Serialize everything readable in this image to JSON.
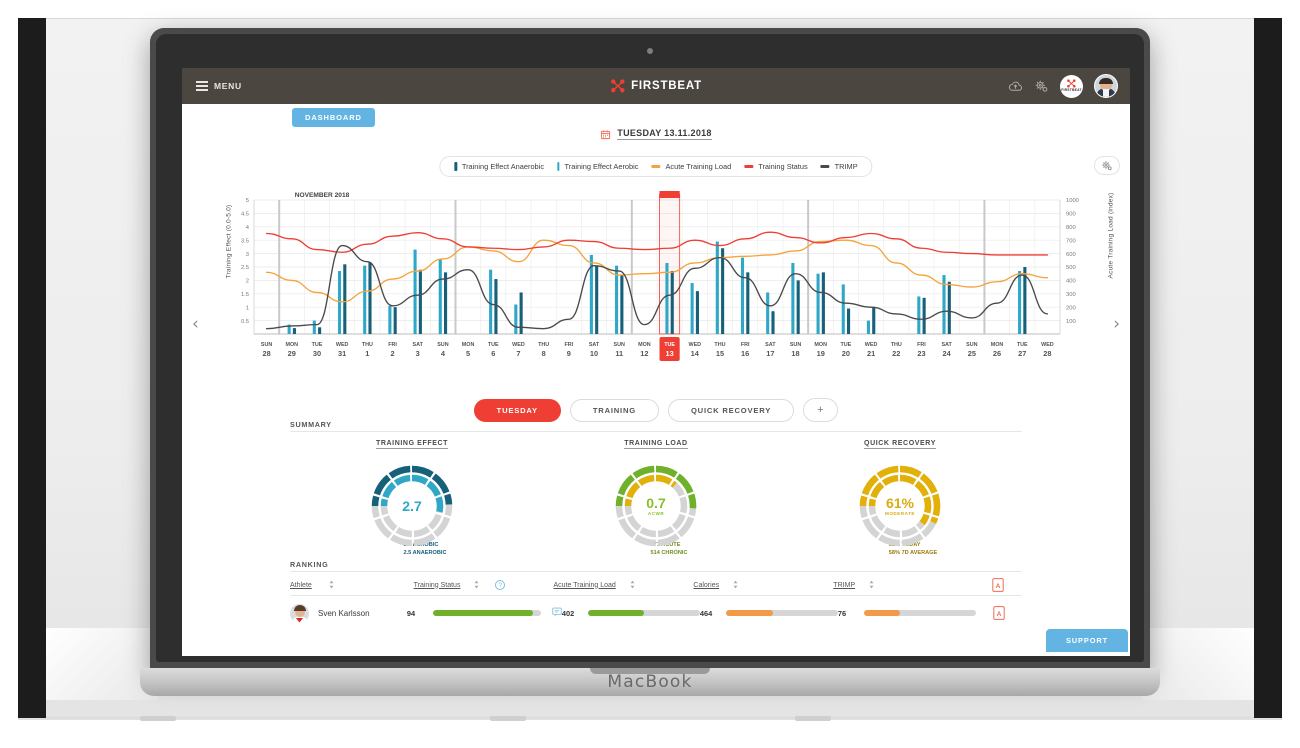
{
  "device": {
    "label": "MacBook"
  },
  "appbar": {
    "menu_label": "MENU",
    "brand": "FIRSTBEAT",
    "badge_text": "FIRSTBEAT",
    "icons": [
      "cloud-upload-icon",
      "settings-gears-icon",
      "firstbeat-badge-icon",
      "user-avatar-icon"
    ]
  },
  "dashboard_tag": "DASHBOARD",
  "date": {
    "text": "TUESDAY 13.11.2018",
    "icon": "calendar-icon"
  },
  "legend": {
    "items": [
      {
        "label": "Training Effect Anaerobic",
        "marker": "bar",
        "color": "#17607a"
      },
      {
        "label": "Training Effect Aerobic",
        "marker": "bar",
        "color": "#2fa8c8"
      },
      {
        "label": "Acute Training Load",
        "marker": "line",
        "color": "#f5a33c"
      },
      {
        "label": "Training Status",
        "marker": "line",
        "color": "#ef3e33"
      },
      {
        "label": "TRIMP",
        "marker": "line",
        "color": "#4a4a4a"
      }
    ],
    "settings_icon": "chart-settings-icon"
  },
  "nav": {
    "prev": "‹",
    "next": "›"
  },
  "tabs": [
    {
      "label": "TUESDAY",
      "active": true
    },
    {
      "label": "TRAINING",
      "active": false
    },
    {
      "label": "QUICK RECOVERY",
      "active": false
    },
    {
      "label": "+",
      "active": false
    }
  ],
  "summary": {
    "section_label": "SUMMARY",
    "cards": [
      {
        "title": "TRAINING EFFECT",
        "main": "2.7",
        "sub": "",
        "main_color": "#2fa8c8",
        "caption": [
          "2.7 AEROBIC",
          "2.5 ANAEROBIC"
        ],
        "caption_color": "#17607a",
        "rings": [
          {
            "value": 2.7,
            "max": 5.0,
            "color": "#2fa8c8",
            "r": 28
          },
          {
            "value": 2.5,
            "max": 5.0,
            "color": "#17607a",
            "r": 37
          }
        ]
      },
      {
        "title": "TRAINING LOAD",
        "main": "0.7",
        "sub": "ACWR",
        "main_color": "#8bbf2a",
        "caption": [
          "371 ACUTE",
          "514 CHRONIC"
        ],
        "caption_color": "#6f8f1e",
        "rings": [
          {
            "value": 371,
            "max": 1000,
            "color": "#e3b007",
            "r": 28
          },
          {
            "value": 514,
            "max": 1000,
            "color": "#6fb12a",
            "r": 37
          }
        ]
      },
      {
        "title": "QUICK RECOVERY",
        "main": "61%",
        "sub": "MODERATE",
        "main_color": "#d9ac10",
        "caption": [
          "61% TODAY",
          "58% 7D AVERAGE"
        ],
        "caption_color": "#9a7c0a",
        "rings": [
          {
            "value": 61,
            "max": 100,
            "color": "#e3b007",
            "r": 28
          },
          {
            "value": 58,
            "max": 100,
            "color": "#e3b007",
            "r": 37
          }
        ]
      }
    ]
  },
  "ranking": {
    "section_label": "RANKING",
    "columns": [
      {
        "label": "Athlete",
        "sortable": true
      },
      {
        "label": "Training Status",
        "sortable": true,
        "has_help": true
      },
      {
        "label": "Acute Training Load",
        "sortable": true
      },
      {
        "label": "Calories",
        "sortable": true
      },
      {
        "label": "TRIMP",
        "sortable": true
      }
    ],
    "rows": [
      {
        "name": "Sven Karlsson",
        "training_status": {
          "value": "94",
          "pct": 93,
          "color": "#6fb12a",
          "note_icon": "comment-icon"
        },
        "acute_training_load": {
          "value": "402",
          "pct": 50,
          "color": "#6fb12a"
        },
        "calories": {
          "value": "464",
          "pct": 42,
          "color": "#f2994a"
        },
        "trimp": {
          "value": "76",
          "pct": 32,
          "color": "#f2994a"
        },
        "pdf_icon": "pdf-download-icon"
      }
    ]
  },
  "support": {
    "label": "SUPPORT"
  },
  "chart_data": {
    "type": "bar",
    "title": "NOVEMBER 2018",
    "xlabel": "",
    "ylabel": "Training Effect (0.0-5.0)",
    "y2label": "Acute Training Load (index)",
    "ylim": [
      0,
      5
    ],
    "yticks": [
      0.5,
      1,
      1.5,
      2,
      2.5,
      3,
      3.5,
      4,
      4.5,
      5
    ],
    "y2lim": [
      0,
      1000
    ],
    "y2ticks": [
      100,
      200,
      300,
      400,
      500,
      600,
      700,
      800,
      900,
      1000
    ],
    "grid": true,
    "legend_position": "top",
    "selected_index": 16,
    "categories": [
      {
        "dow": "SUN",
        "day": "28"
      },
      {
        "dow": "MON",
        "day": "29"
      },
      {
        "dow": "TUE",
        "day": "30"
      },
      {
        "dow": "WED",
        "day": "31"
      },
      {
        "dow": "THU",
        "day": "1"
      },
      {
        "dow": "FRI",
        "day": "2"
      },
      {
        "dow": "SAT",
        "day": "3"
      },
      {
        "dow": "SUN",
        "day": "4"
      },
      {
        "dow": "MON",
        "day": "5"
      },
      {
        "dow": "TUE",
        "day": "6"
      },
      {
        "dow": "WED",
        "day": "7"
      },
      {
        "dow": "THU",
        "day": "8"
      },
      {
        "dow": "FRI",
        "day": "9"
      },
      {
        "dow": "SAT",
        "day": "10"
      },
      {
        "dow": "SUN",
        "day": "11"
      },
      {
        "dow": "MON",
        "day": "12"
      },
      {
        "dow": "TUE",
        "day": "13"
      },
      {
        "dow": "WED",
        "day": "14"
      },
      {
        "dow": "THU",
        "day": "15"
      },
      {
        "dow": "FRI",
        "day": "16"
      },
      {
        "dow": "SAT",
        "day": "17"
      },
      {
        "dow": "SUN",
        "day": "18"
      },
      {
        "dow": "MON",
        "day": "19"
      },
      {
        "dow": "TUE",
        "day": "20"
      },
      {
        "dow": "WED",
        "day": "21"
      },
      {
        "dow": "THU",
        "day": "22"
      },
      {
        "dow": "FRI",
        "day": "23"
      },
      {
        "dow": "SAT",
        "day": "24"
      },
      {
        "dow": "SUN",
        "day": "25"
      },
      {
        "dow": "MON",
        "day": "26"
      },
      {
        "dow": "TUE",
        "day": "27"
      },
      {
        "dow": "WED",
        "day": "28"
      }
    ],
    "series": [
      {
        "name": "Training Effect Aerobic",
        "type": "bar",
        "color": "#2fa8c8",
        "values": [
          0,
          0.35,
          0.5,
          2.35,
          2.55,
          1.05,
          3.15,
          2.8,
          0,
          2.4,
          1.1,
          0,
          0,
          2.95,
          2.55,
          0,
          2.65,
          1.9,
          3.45,
          2.85,
          1.55,
          2.65,
          2.25,
          1.85,
          0.5,
          0,
          1.4,
          2.2,
          0,
          0,
          2.35,
          0
        ]
      },
      {
        "name": "Training Effect Anaerobic",
        "type": "bar",
        "color": "#17607a",
        "values": [
          0,
          0.22,
          0.25,
          2.6,
          2.68,
          1.0,
          2.4,
          2.3,
          0,
          2.05,
          1.55,
          0,
          0,
          2.55,
          2.2,
          0,
          2.35,
          1.6,
          3.2,
          2.3,
          0.85,
          2.0,
          2.3,
          0.95,
          1.0,
          0,
          1.35,
          1.95,
          0,
          0,
          2.5,
          0
        ]
      },
      {
        "name": "Acute Training Load",
        "type": "line",
        "color": "#f5a33c",
        "axis": "right",
        "values": [
          2.3,
          2.0,
          1.55,
          1.2,
          1.6,
          2.05,
          2.35,
          2.8,
          3.25,
          3.1,
          2.7,
          3.5,
          3.3,
          2.65,
          2.2,
          2.25,
          2.3,
          2.65,
          2.85,
          2.9,
          2.95,
          3.1,
          3.45,
          3.5,
          3.3,
          2.65,
          2.2,
          1.85,
          1.75,
          1.95,
          2.25,
          2.1
        ]
      },
      {
        "name": "Training Status",
        "type": "line",
        "color": "#ef3e33",
        "axis": "left",
        "values": [
          3.75,
          3.55,
          3.15,
          3.05,
          3.35,
          3.65,
          3.78,
          3.55,
          3.25,
          3.2,
          3.15,
          3.25,
          3.5,
          3.45,
          3.2,
          3.15,
          3.2,
          3.5,
          3.3,
          3.55,
          3.8,
          3.6,
          3.4,
          3.6,
          3.75,
          3.55,
          3.2,
          3.05,
          3.0,
          2.95,
          2.95,
          2.95
        ]
      },
      {
        "name": "TRIMP",
        "type": "line",
        "color": "#4a4a4a",
        "axis": "left",
        "values": [
          0.2,
          0.3,
          0.35,
          3.3,
          2.7,
          1.05,
          1.45,
          2.05,
          2.4,
          1.1,
          0.25,
          0.2,
          0.55,
          2.55,
          2.35,
          0.35,
          1.45,
          2.45,
          2.85,
          2.1,
          1.05,
          2.25,
          1.55,
          1.15,
          1.0,
          0.75,
          0.55,
          0.85,
          0.6,
          1.15,
          2.2,
          0.75
        ]
      }
    ],
    "week_separator_indices": [
      1,
      8,
      15,
      22,
      29
    ]
  }
}
